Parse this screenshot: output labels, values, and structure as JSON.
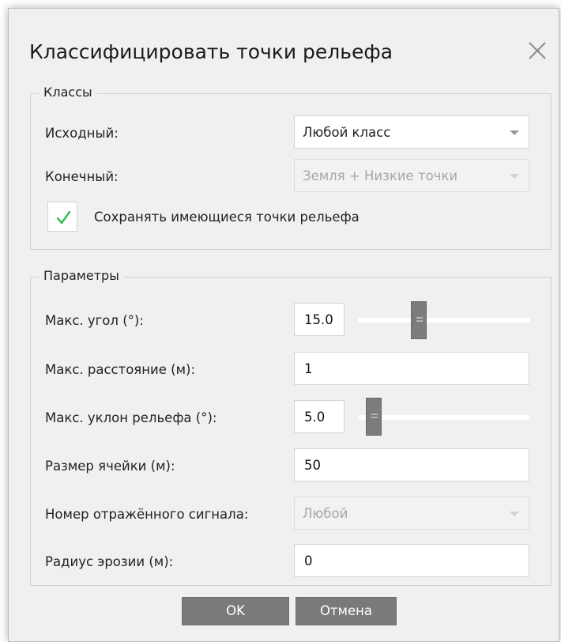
{
  "dialog": {
    "title": "Классифицировать точки рельефа"
  },
  "icons": {
    "close": "close-icon",
    "checkbox_check": "check-icon",
    "dropdown": "chevron-down-icon"
  },
  "classes": {
    "caption": "Классы",
    "source": {
      "label": "Исходный:",
      "value": "Любой класс",
      "enabled": true
    },
    "target": {
      "label": "Конечный:",
      "value": "Земля + Низкие точки",
      "enabled": false
    },
    "keep_existing": {
      "label": "Сохранять имеющиеся точки рельефа",
      "checked": true
    }
  },
  "params": {
    "caption": "Параметры",
    "max_angle": {
      "label": "Макс. угол (°):",
      "value": "15.0",
      "slider_fraction": 0.34
    },
    "max_distance": {
      "label": "Макс. расстояние (м):",
      "value": "1"
    },
    "max_slope": {
      "label": "Макс. уклон рельефа (°):",
      "value": "5.0",
      "slider_fraction": 0.05
    },
    "cell_size": {
      "label": "Размер ячейки (м):",
      "value": "50"
    },
    "return_number": {
      "label": "Номер отражённого сигнала:",
      "value": "Любой",
      "enabled": false
    },
    "erosion_radius": {
      "label": "Радиус эрозии (м):",
      "value": "0"
    }
  },
  "buttons": {
    "ok": "OK",
    "cancel": "Отмена"
  },
  "colors": {
    "dialog_bg": "#f0f0f0",
    "button_bg": "#7a7a7a",
    "check_green": "#2ebd59",
    "slider_thumb": "#7c7c7c"
  }
}
